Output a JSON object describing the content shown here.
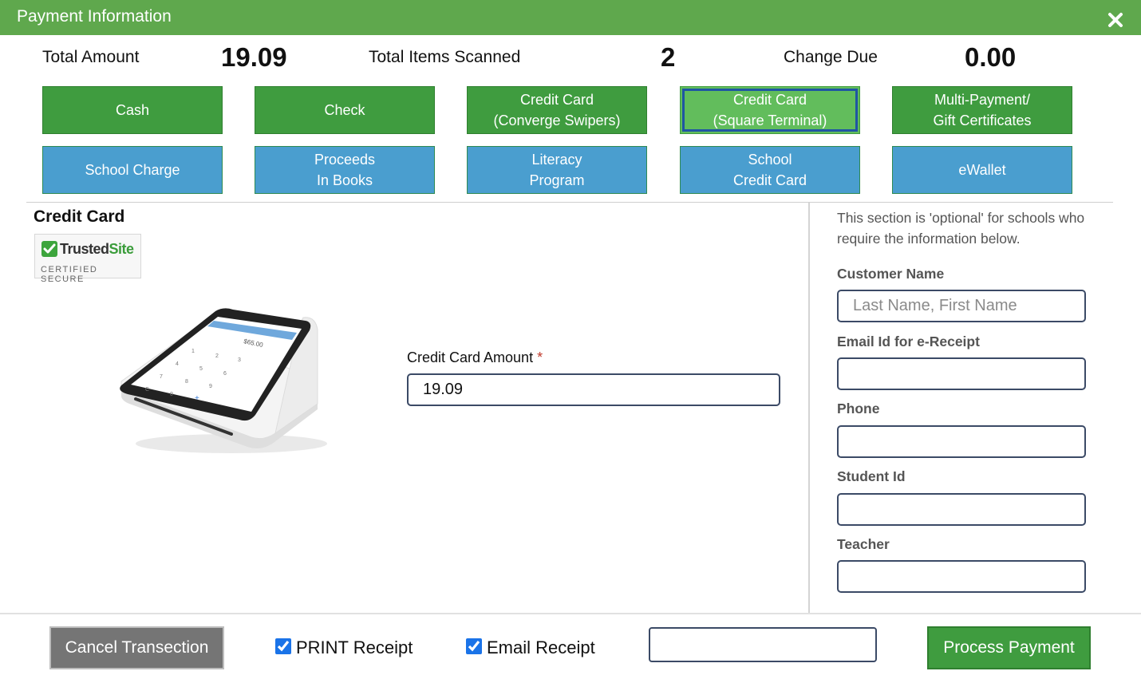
{
  "window": {
    "title": "Payment Information",
    "close_icon": "close-icon"
  },
  "summary": {
    "total_amount_label": "Total Amount",
    "total_amount_value": "19.09",
    "items_label": "Total Items Scanned",
    "items_value": "2",
    "change_label": "Change Due",
    "change_value": "0.00"
  },
  "payment_methods": [
    {
      "line1": "Cash",
      "line2": "",
      "color": "#3f9c3f",
      "selected": false
    },
    {
      "line1": "Check",
      "line2": "",
      "color": "#3f9c3f",
      "selected": false
    },
    {
      "line1": "Credit Card",
      "line2": "(Converge Swipers)",
      "color": "#3f9c3f",
      "selected": false
    },
    {
      "line1": "Credit Card",
      "line2": "(Square Terminal)",
      "color": "#62bd5c",
      "selected": true
    },
    {
      "line1": "Multi-Payment/",
      "line2": "Gift Certificates",
      "color": "#3f9c3f",
      "selected": false
    },
    {
      "line1": "School Charge",
      "line2": "",
      "color": "#4a9ecf",
      "selected": false
    },
    {
      "line1": "Proceeds",
      "line2": "In Books",
      "color": "#4a9ecf",
      "selected": false
    },
    {
      "line1": "Literacy",
      "line2": "Program",
      "color": "#4a9ecf",
      "selected": false
    },
    {
      "line1": "School",
      "line2": "Credit Card",
      "color": "#4a9ecf",
      "selected": false
    },
    {
      "line1": "eWallet",
      "line2": "",
      "color": "#4a9ecf",
      "selected": false
    }
  ],
  "credit_card": {
    "section_title": "Credit Card",
    "badge": {
      "brand_a": "Trusted",
      "brand_b": "Site",
      "tagline": "CERTIFIED SECURE"
    },
    "terminal_screen": {
      "amount": "$65.00"
    },
    "amount_label": "Credit Card Amount",
    "required_mark": "*",
    "amount_value": "19.09"
  },
  "optional_info": {
    "note": "This section is 'optional' for schools who require the information below.",
    "customer_name_label": "Customer Name",
    "customer_name_placeholder": "Last Name, First Name",
    "email_label": "Email Id for e-Receipt",
    "phone_label": "Phone",
    "student_id_label": "Student Id",
    "teacher_label": "Teacher"
  },
  "footer": {
    "cancel_label": "Cancel Transection",
    "print_receipt_label": "PRINT Receipt",
    "print_receipt_checked": true,
    "email_receipt_label": "Email Receipt",
    "email_receipt_checked": true,
    "email_value": "",
    "process_label": "Process Payment"
  }
}
